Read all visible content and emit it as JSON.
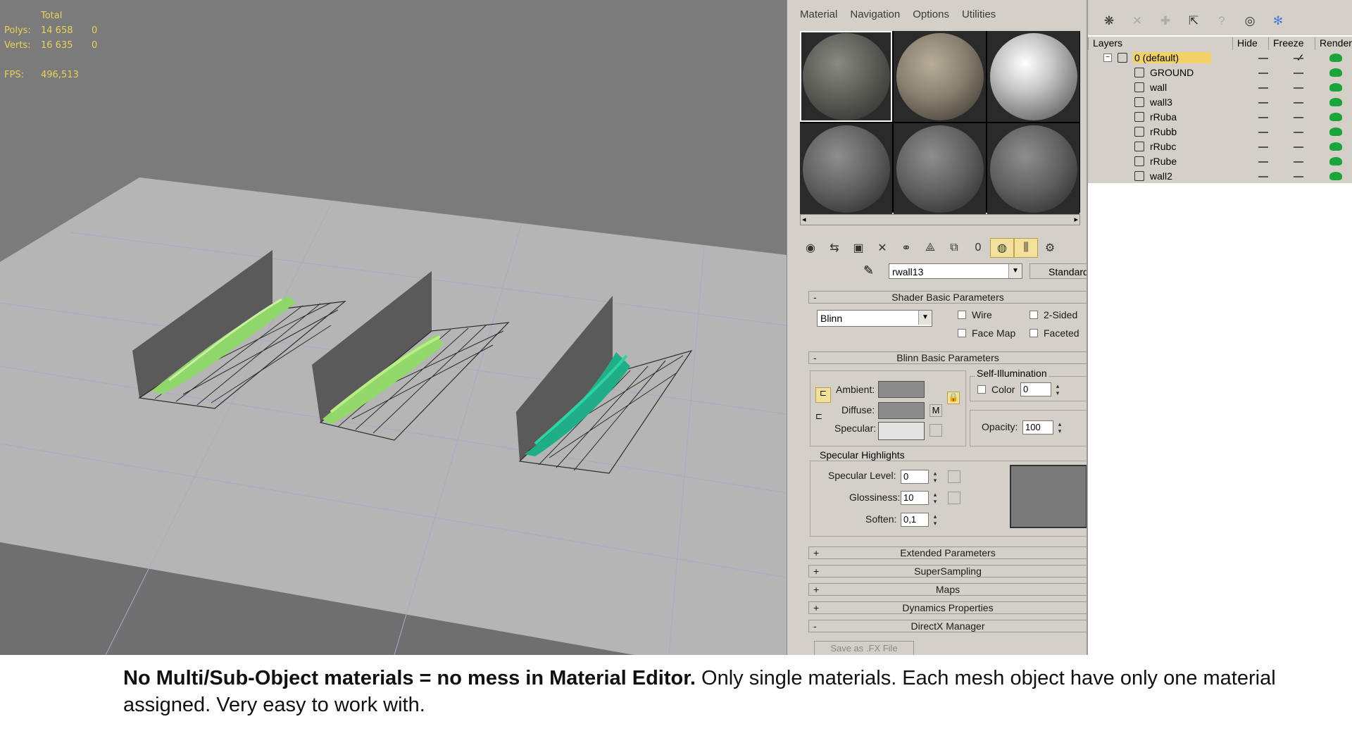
{
  "viewport": {
    "stats": {
      "header": "Total",
      "polys_label": "Polys:",
      "polys_total": "14 658",
      "polys_sel": "0",
      "verts_label": "Verts:",
      "verts_total": "16 635",
      "verts_sel": "0",
      "fps_label": "FPS:",
      "fps_value": "496,513"
    }
  },
  "material_editor": {
    "menu": [
      "Material",
      "Navigation",
      "Options",
      "Utilities"
    ],
    "material_name": "rwall13",
    "material_type": "Standard",
    "shader_rollout": "Shader Basic Parameters",
    "shader_type": "Blinn",
    "shader_options": {
      "wire": "Wire",
      "two_sided": "2-Sided",
      "face_map": "Face Map",
      "faceted": "Faceted"
    },
    "blinn_rollout": "Blinn Basic Parameters",
    "ambient_label": "Ambient:",
    "diffuse_label": "Diffuse:",
    "specular_label": "Specular:",
    "map_button": "M",
    "self_illum_title": "Self-Illumination",
    "color_label": "Color",
    "color_value": "0",
    "opacity_label": "Opacity:",
    "opacity_value": "100",
    "spec_title": "Specular Highlights",
    "spec_level_label": "Specular Level:",
    "spec_level_value": "0",
    "glossiness_label": "Glossiness:",
    "glossiness_value": "10",
    "soften_label": "Soften:",
    "soften_value": "0,1",
    "rollouts_collapsed": [
      {
        "sign": "+",
        "label": "Extended Parameters"
      },
      {
        "sign": "+",
        "label": "SuperSampling"
      },
      {
        "sign": "+",
        "label": "Maps"
      },
      {
        "sign": "+",
        "label": "Dynamics Properties"
      },
      {
        "sign": "-",
        "label": "DirectX Manager"
      }
    ],
    "save_fx_button": "Save as .FX File"
  },
  "layer_panel": {
    "columns": [
      "Layers",
      "Hide",
      "Freeze",
      "Render"
    ],
    "default_layer": "0 (default)",
    "objects": [
      "GROUND",
      "wall",
      "wall3",
      "rRuba",
      "rRubb",
      "rRubc",
      "rRube",
      "wall2"
    ]
  },
  "caption": {
    "bold": "No Multi/Sub-Object materials = no mess in Material Editor.",
    "rest": " Only single materials. Each mesh object have only one material assigned. Very easy to work with."
  }
}
